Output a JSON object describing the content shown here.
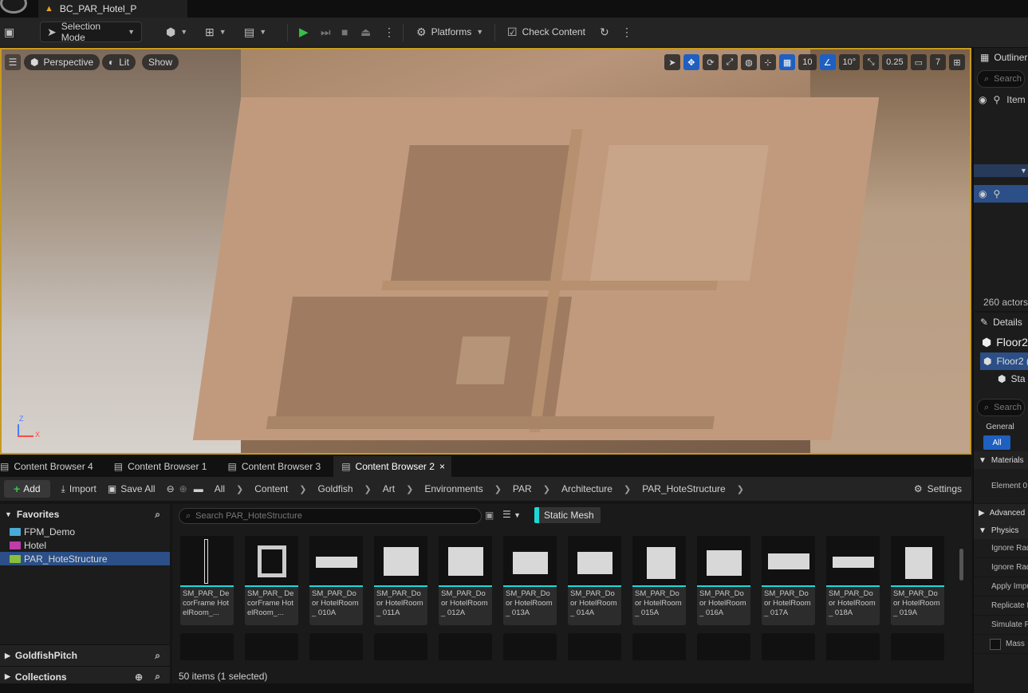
{
  "title_bar": {
    "level_name": "BC_PAR_Hotel_P"
  },
  "toolbar": {
    "mode": "Selection Mode",
    "platforms": "Platforms",
    "check_content": "Check Content"
  },
  "viewport": {
    "view_mode": "Perspective",
    "lighting": "Lit",
    "show": "Show",
    "grid_snap": "10",
    "rotate_snap": "10°",
    "scale_snap": "0.25",
    "camera_speed": "7",
    "axis_z": "Z",
    "axis_x": "X",
    "accent_color": "#c79a1f"
  },
  "outliner": {
    "title": "Outliner",
    "search_placeholder": "Search",
    "column_label": "Item",
    "actor_count": "260 actors"
  },
  "details": {
    "title": "Details",
    "actor_name": "Floor2",
    "component_selected": "Floor2 (",
    "component_child": "Sta",
    "search_placeholder": "Search",
    "filter_general": "General",
    "filter_all": "All",
    "categories": {
      "materials": "Materials",
      "advanced": "Advanced",
      "physics": "Physics"
    },
    "properties": {
      "element0": "Element 0",
      "ignore1": "Ignore Rad",
      "ignore2": "Ignore Rad",
      "apply": "Apply Impu",
      "replicate": "Replicate P",
      "simulate": "Simulate P",
      "mass": "Mass"
    }
  },
  "content_browser": {
    "tabs": [
      "Content Browser 4",
      "Content Browser 1",
      "Content Browser 3",
      "Content Browser 2"
    ],
    "active_tab_close": "×",
    "add": "Add",
    "import": "Import",
    "save_all": "Save All",
    "breadcrumb": [
      "All",
      "Content",
      "Goldfish",
      "Art",
      "Environments",
      "PAR",
      "Architecture",
      "PAR_HoteStructure"
    ],
    "settings": "Settings",
    "search_placeholder": "Search PAR_HoteStructure",
    "filter": "Static Mesh",
    "status": "50 items (1 selected)",
    "assets": [
      "SM_PAR_ DecorFrame HotelRoom_...",
      "SM_PAR_ DecorFrame HotelRoom_...",
      "SM_PAR_Door HotelRoom_ 010A",
      "SM_PAR_Door HotelRoom_ 011A",
      "SM_PAR_Door HotelRoom_ 012A",
      "SM_PAR_Door HotelRoom_ 013A",
      "SM_PAR_Door HotelRoom_ 014A",
      "SM_PAR_Door HotelRoom_ 015A",
      "SM_PAR_Door HotelRoom_ 016A",
      "SM_PAR_Door HotelRoom_ 017A",
      "SM_PAR_Door HotelRoom_ 018A",
      "SM_PAR_Door HotelRoom_ 019A"
    ]
  },
  "sources": {
    "favorites_title": "Favorites",
    "favorites": [
      "FPM_Demo",
      "Hotel",
      "PAR_HoteStructure"
    ],
    "goldfish_pitch": "GoldfishPitch",
    "collections": "Collections"
  }
}
